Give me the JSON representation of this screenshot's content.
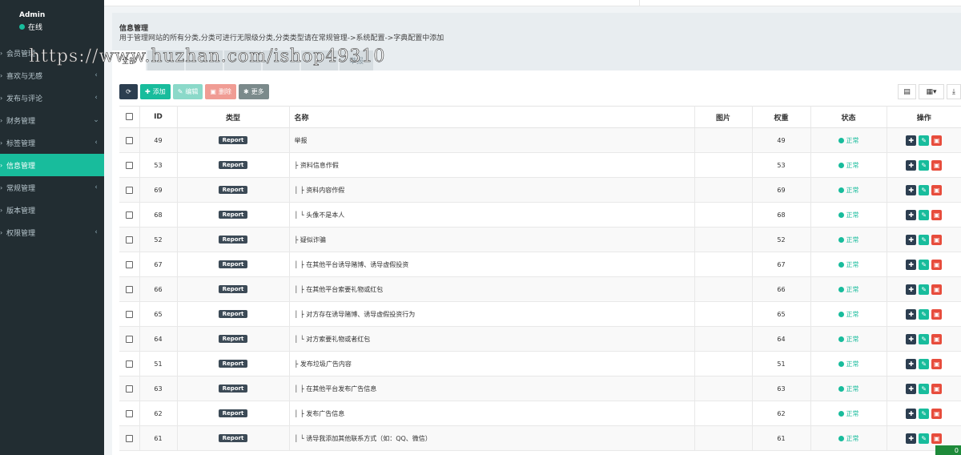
{
  "sidebar": {
    "user": {
      "name": "Admin",
      "status": "在线"
    },
    "items": [
      {
        "label": "会员管理",
        "chevron": "‹"
      },
      {
        "label": "喜欢与无感",
        "chevron": "‹"
      },
      {
        "label": "发布与评论",
        "chevron": "‹"
      },
      {
        "label": "财务管理",
        "chevron": "⌄"
      },
      {
        "label": "标签管理",
        "chevron": "‹"
      },
      {
        "label": "信息管理",
        "chevron": ""
      },
      {
        "label": "常规管理",
        "chevron": "‹"
      },
      {
        "label": "版本管理",
        "chevron": ""
      },
      {
        "label": "权限管理",
        "chevron": "‹"
      }
    ]
  },
  "panel": {
    "title": "信息管理",
    "description": "用于管理网站的所有分类,分类可进行无限级分类,分类类型请在常规管理->系统配置->字典配置中添加",
    "tabs": [
      {
        "label": "全部"
      },
      {
        "label": ""
      },
      {
        "label": ""
      },
      {
        "label": ""
      },
      {
        "label": ""
      },
      {
        "label": ""
      },
      {
        "label": "举报"
      }
    ]
  },
  "toolbar": {
    "refresh_icon": "refresh-icon",
    "add_label": "添加",
    "edit_label": "编辑",
    "delete_label": "删除",
    "more_label": "更多"
  },
  "table": {
    "headers": {
      "id": "ID",
      "type": "类型",
      "name": "名称",
      "image": "图片",
      "weight": "权重",
      "status": "状态",
      "ops": "操作"
    },
    "rows": [
      {
        "id": "49",
        "type": "Report",
        "name": "举报",
        "weight": "49",
        "status": "正常"
      },
      {
        "id": "53",
        "type": "Report",
        "name": "├ 资料信息作假",
        "weight": "53",
        "status": "正常"
      },
      {
        "id": "69",
        "type": "Report",
        "name": "│ ├ 资料内容作假",
        "weight": "69",
        "status": "正常"
      },
      {
        "id": "68",
        "type": "Report",
        "name": "│ └ 头像不是本人",
        "weight": "68",
        "status": "正常"
      },
      {
        "id": "52",
        "type": "Report",
        "name": "├ 疑似诈骗",
        "weight": "52",
        "status": "正常"
      },
      {
        "id": "67",
        "type": "Report",
        "name": "│ ├ 在其他平台诱导赌博、诱导虚假投资",
        "weight": "67",
        "status": "正常"
      },
      {
        "id": "66",
        "type": "Report",
        "name": "│ ├ 在其他平台索要礼物或红包",
        "weight": "66",
        "status": "正常"
      },
      {
        "id": "65",
        "type": "Report",
        "name": "│ ├ 对方存在诱导赌博、诱导虚假投资行为",
        "weight": "65",
        "status": "正常"
      },
      {
        "id": "64",
        "type": "Report",
        "name": "│ └ 对方索要礼物或者红包",
        "weight": "64",
        "status": "正常"
      },
      {
        "id": "51",
        "type": "Report",
        "name": "├ 发布垃圾广告内容",
        "weight": "51",
        "status": "正常"
      },
      {
        "id": "63",
        "type": "Report",
        "name": "│ ├ 在其他平台发布广告信息",
        "weight": "63",
        "status": "正常"
      },
      {
        "id": "62",
        "type": "Report",
        "name": "│ ├ 发布广告信息",
        "weight": "62",
        "status": "正常"
      },
      {
        "id": "61",
        "type": "Report",
        "name": "│ └ 诱导我添加其他联系方式（如：QQ、微信）",
        "weight": "61",
        "status": "正常"
      }
    ]
  },
  "watermark": "https://www.huzhan.com/ishop49310",
  "corner_badge": "0",
  "colors": {
    "accent": "#18bc9c",
    "sidebar": "#222d32",
    "danger": "#e74c3c",
    "dark": "#2c3e50"
  }
}
